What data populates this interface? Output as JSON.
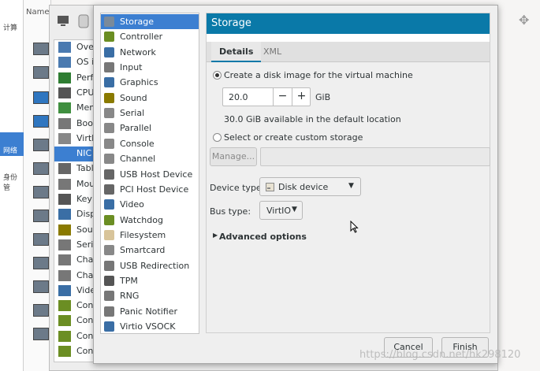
{
  "background": {
    "categories": [
      "计算",
      "网络",
      "身份管"
    ],
    "name_column_label": "Name"
  },
  "behind_list": {
    "items": [
      {
        "label": "Over",
        "icon": "overview-icon",
        "color": "#4a7ab0"
      },
      {
        "label": "OS in",
        "icon": "os-icon",
        "color": "#4a7ab0"
      },
      {
        "label": "Perfo",
        "icon": "performance-icon",
        "color": "#2e7d32"
      },
      {
        "label": "CPUs",
        "icon": "cpu-icon",
        "color": "#555555"
      },
      {
        "label": "Mem",
        "icon": "memory-icon",
        "color": "#3f8f3f"
      },
      {
        "label": "Boot",
        "icon": "boot-icon",
        "color": "#777777"
      },
      {
        "label": "VirtIO",
        "icon": "disk-icon",
        "color": "#888888"
      },
      {
        "label": "NIC",
        "icon": "nic-icon",
        "color": "#3c7fd1",
        "selected": true
      },
      {
        "label": "Table",
        "icon": "tablet-icon",
        "color": "#666666"
      },
      {
        "label": "Mous",
        "icon": "mouse-icon",
        "color": "#777777"
      },
      {
        "label": "Keyb",
        "icon": "keyboard-icon",
        "color": "#555555"
      },
      {
        "label": "Displ",
        "icon": "display-icon",
        "color": "#3a6ea5"
      },
      {
        "label": "Soun",
        "icon": "sound-icon",
        "color": "#8a7a00"
      },
      {
        "label": "Seria",
        "icon": "serial-icon",
        "color": "#777777"
      },
      {
        "label": "Chan",
        "icon": "channel-icon",
        "color": "#777777"
      },
      {
        "label": "Chan",
        "icon": "channel-icon",
        "color": "#777777"
      },
      {
        "label": "Video",
        "icon": "video-icon",
        "color": "#3a6ea5"
      },
      {
        "label": "Cont",
        "icon": "controller-icon",
        "color": "#6b8e23"
      },
      {
        "label": "Cont",
        "icon": "controller-icon",
        "color": "#6b8e23"
      },
      {
        "label": "Cont",
        "icon": "controller-icon",
        "color": "#6b8e23"
      },
      {
        "label": "Cont",
        "icon": "controller-icon",
        "color": "#6b8e23"
      }
    ]
  },
  "hardware_list": {
    "items": [
      {
        "label": "Storage",
        "icon": "storage-icon",
        "color": "#7a8a9a",
        "selected": true
      },
      {
        "label": "Controller",
        "icon": "controller-icon",
        "color": "#6b8e23"
      },
      {
        "label": "Network",
        "icon": "network-icon",
        "color": "#3a6ea5"
      },
      {
        "label": "Input",
        "icon": "input-icon",
        "color": "#777777"
      },
      {
        "label": "Graphics",
        "icon": "graphics-icon",
        "color": "#3a6ea5"
      },
      {
        "label": "Sound",
        "icon": "sound-icon",
        "color": "#8a7a00"
      },
      {
        "label": "Serial",
        "icon": "serial-icon",
        "color": "#888888"
      },
      {
        "label": "Parallel",
        "icon": "parallel-icon",
        "color": "#888888"
      },
      {
        "label": "Console",
        "icon": "console-icon",
        "color": "#888888"
      },
      {
        "label": "Channel",
        "icon": "channel-icon",
        "color": "#888888"
      },
      {
        "label": "USB Host Device",
        "icon": "usb-icon",
        "color": "#666666"
      },
      {
        "label": "PCI Host Device",
        "icon": "pci-icon",
        "color": "#666666"
      },
      {
        "label": "Video",
        "icon": "video-icon",
        "color": "#3a6ea5"
      },
      {
        "label": "Watchdog",
        "icon": "watchdog-icon",
        "color": "#6b8e23"
      },
      {
        "label": "Filesystem",
        "icon": "folder-icon",
        "color": "#d8c49a"
      },
      {
        "label": "Smartcard",
        "icon": "smartcard-icon",
        "color": "#888888"
      },
      {
        "label": "USB Redirection",
        "icon": "usb-redirect-icon",
        "color": "#777777"
      },
      {
        "label": "TPM",
        "icon": "tpm-icon",
        "color": "#555555"
      },
      {
        "label": "RNG",
        "icon": "rng-icon",
        "color": "#777777"
      },
      {
        "label": "Panic Notifier",
        "icon": "panic-icon",
        "color": "#777777"
      },
      {
        "label": "Virtio VSOCK",
        "icon": "vsock-icon",
        "color": "#3a6ea5"
      }
    ]
  },
  "panel": {
    "title": "Storage",
    "tabs": [
      "Details",
      "XML"
    ],
    "create_disk_label": "Create a disk image for the virtual machine",
    "size_value": "20.0",
    "size_unit": "GiB",
    "minus": "−",
    "plus": "+",
    "available_text": "30.0 GiB available in the default location",
    "custom_storage_label": "Select or create custom storage",
    "manage_label": "Manage...",
    "device_type_label": "Device type:",
    "device_type_value": "Disk device",
    "bus_type_label": "Bus type:",
    "bus_type_value": "VirtIO",
    "advanced_label": "Advanced options"
  },
  "footer": {
    "cancel": "Cancel",
    "finish": "Finish"
  },
  "watermark": "https://blog.csdn.net/hk298120",
  "colors": {
    "accent": "#0a79a8",
    "selection": "#3c7fd1"
  }
}
